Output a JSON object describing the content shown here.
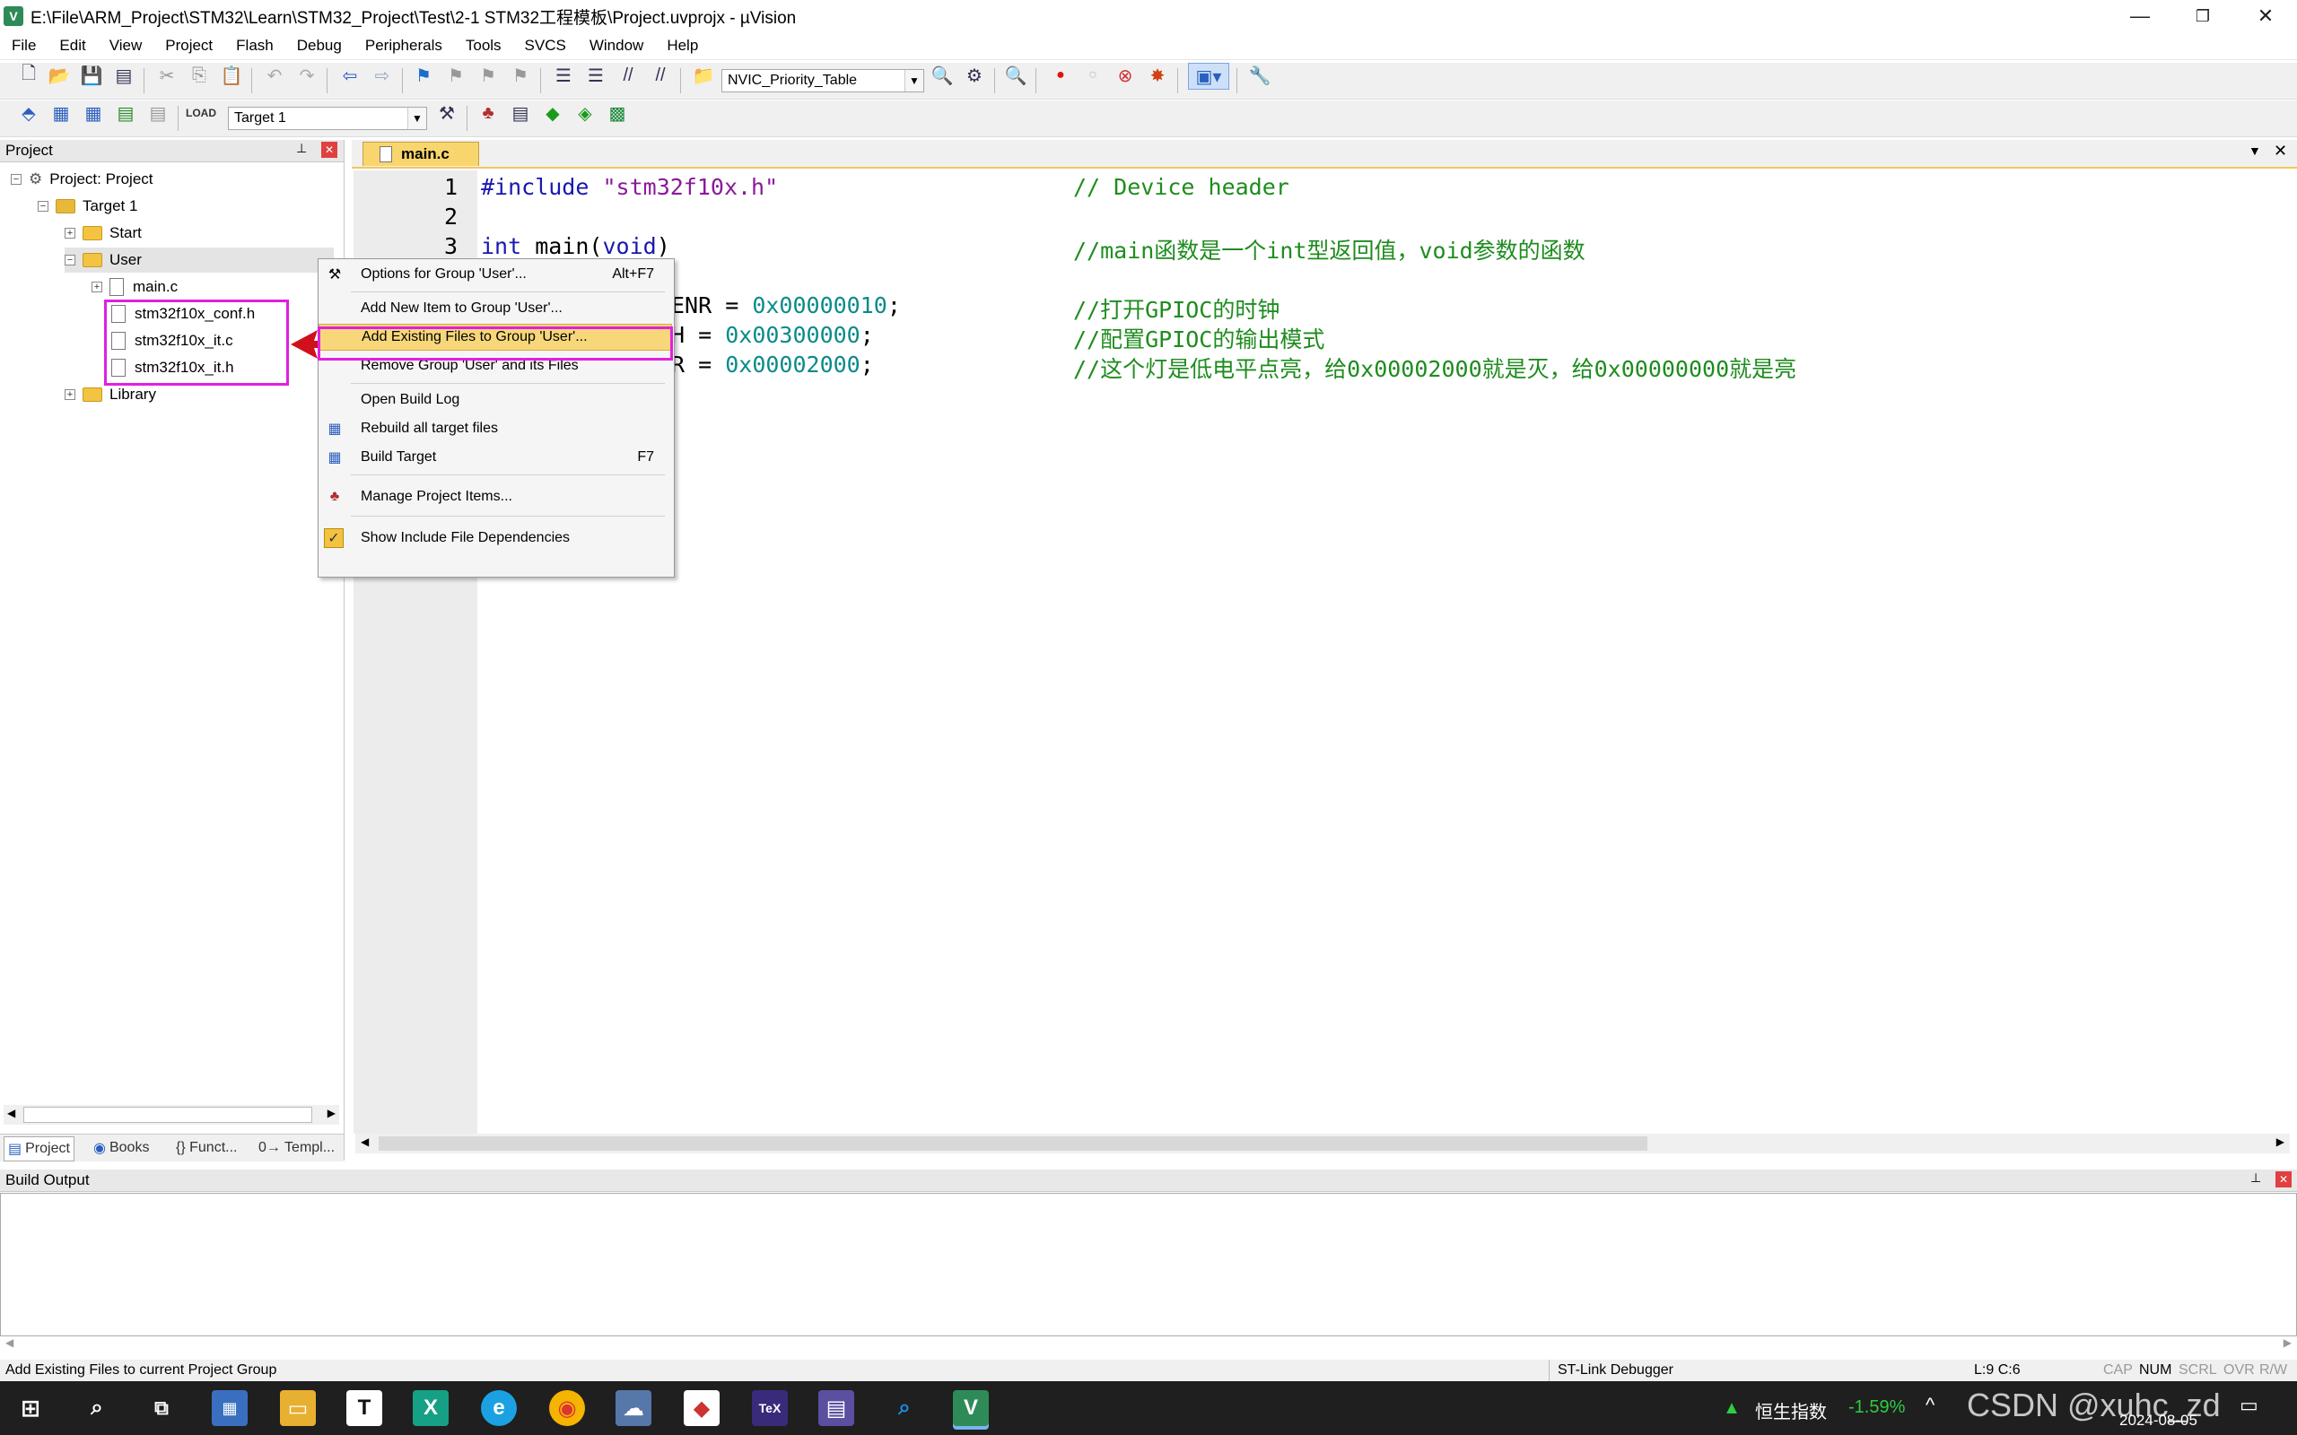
{
  "window": {
    "title": "E:\\File\\ARM_Project\\STM32\\Learn\\STM32_Project\\Test\\2-1 STM32工程模板\\Project.uvprojx - µVision",
    "app_icon": "uvision-icon",
    "minimize": "—",
    "restore": "❐",
    "close": "✕"
  },
  "menu": [
    "File",
    "Edit",
    "View",
    "Project",
    "Flash",
    "Debug",
    "Peripherals",
    "Tools",
    "SVCS",
    "Window",
    "Help"
  ],
  "toolbar1": {
    "find_combo_value": "NVIC_Priority_Table"
  },
  "toolbar2": {
    "target_combo_value": "Target 1"
  },
  "project_panel": {
    "title": "Project",
    "pin": "📌",
    "close": "✕",
    "tree": {
      "root": "Project: Project",
      "target": "Target 1",
      "group_start": "Start",
      "group_user": "User",
      "file_main": "main.c",
      "file_conf": "stm32f10x_conf.h",
      "file_itc": "stm32f10x_it.c",
      "file_ith": "stm32f10x_it.h",
      "group_library": "Library"
    },
    "tabs": [
      "Project",
      "Books",
      "{} Funct...",
      "0→ Templ..."
    ]
  },
  "editor": {
    "tab_label": "main.c",
    "line_numbers": [
      "1",
      "2",
      "3"
    ],
    "line1": {
      "kw": "#include",
      "str": "\"stm32f10x.h\"",
      "cmt": "// Device header"
    },
    "line3": {
      "kw1": "int",
      "mid": " main(",
      "kw2": "void",
      "end": ")",
      "cmt": "//main函数是一个int型返回值，void参数的函数"
    },
    "line5": {
      "code": "ENR = ",
      "num": "0x00000010",
      "end": ";",
      "cmt": "//打开GPIOC的时钟"
    },
    "line6": {
      "code": "H = ",
      "num": "0x00300000",
      "end": ";",
      "cmt": "//配置GPIOC的输出模式"
    },
    "line7": {
      "code": "R = ",
      "num": "0x00002000",
      "end": ";",
      "cmt": "//这个灯是低电平点亮，给0x00002000就是灭，给0x00000000就是亮"
    }
  },
  "context_menu": {
    "items": [
      {
        "label": "Options for Group 'User'...",
        "shortcut": "Alt+F7"
      },
      {
        "label": "Add New  Item to Group 'User'...",
        "shortcut": ""
      },
      {
        "label": "Add Existing Files to Group 'User'...",
        "shortcut": ""
      },
      {
        "label": "Remove Group 'User' and its Files",
        "shortcut": ""
      },
      {
        "label": "Open Build Log",
        "shortcut": ""
      },
      {
        "label": "Rebuild all target files",
        "shortcut": ""
      },
      {
        "label": "Build Target",
        "shortcut": "F7"
      },
      {
        "label": "Manage Project Items...",
        "shortcut": ""
      },
      {
        "label": "Show Include File Dependencies",
        "shortcut": ""
      }
    ],
    "highlighted_index": 2,
    "highlight_color": "#f7d77a"
  },
  "build_output": {
    "title": "Build Output"
  },
  "statusbar": {
    "message": "Add Existing Files to current Project Group",
    "debugger": "ST-Link Debugger",
    "position": "L:9 C:6",
    "indicators": [
      "CAP",
      "NUM",
      "SCRL",
      "OVR",
      "R/W"
    ]
  },
  "taskbar": {
    "stock_name": "恒生指数",
    "stock_change": "-1.59%",
    "date": "2024-08-05",
    "watermark": "CSDN @xuhc_zd"
  },
  "colors": {
    "annotation": "#e020e0",
    "arrow": "#d0101a",
    "tab_accent": "#f5c65a"
  }
}
